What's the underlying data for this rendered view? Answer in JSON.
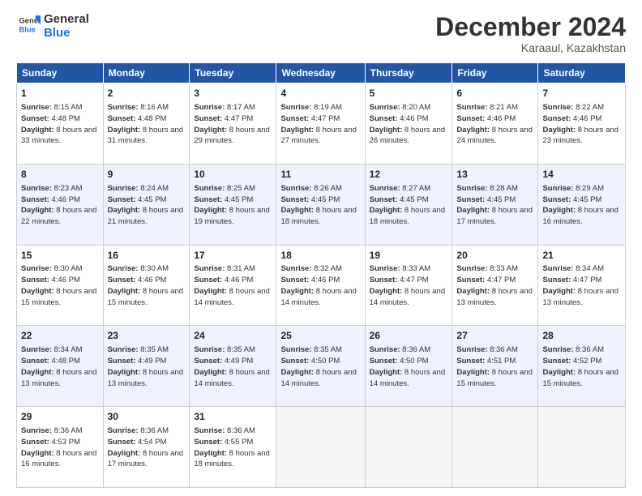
{
  "header": {
    "logo_line1": "General",
    "logo_line2": "Blue",
    "month": "December 2024",
    "location": "Karaaul, Kazakhstan"
  },
  "days_of_week": [
    "Sunday",
    "Monday",
    "Tuesday",
    "Wednesday",
    "Thursday",
    "Friday",
    "Saturday"
  ],
  "weeks": [
    [
      {
        "day": 1,
        "sunrise": "8:15 AM",
        "sunset": "4:48 PM",
        "daylight": "8 hours and 33 minutes."
      },
      {
        "day": 2,
        "sunrise": "8:16 AM",
        "sunset": "4:48 PM",
        "daylight": "8 hours and 31 minutes."
      },
      {
        "day": 3,
        "sunrise": "8:17 AM",
        "sunset": "4:47 PM",
        "daylight": "8 hours and 29 minutes."
      },
      {
        "day": 4,
        "sunrise": "8:19 AM",
        "sunset": "4:47 PM",
        "daylight": "8 hours and 27 minutes."
      },
      {
        "day": 5,
        "sunrise": "8:20 AM",
        "sunset": "4:46 PM",
        "daylight": "8 hours and 26 minutes."
      },
      {
        "day": 6,
        "sunrise": "8:21 AM",
        "sunset": "4:46 PM",
        "daylight": "8 hours and 24 minutes."
      },
      {
        "day": 7,
        "sunrise": "8:22 AM",
        "sunset": "4:46 PM",
        "daylight": "8 hours and 23 minutes."
      }
    ],
    [
      {
        "day": 8,
        "sunrise": "8:23 AM",
        "sunset": "4:46 PM",
        "daylight": "8 hours and 22 minutes."
      },
      {
        "day": 9,
        "sunrise": "8:24 AM",
        "sunset": "4:45 PM",
        "daylight": "8 hours and 21 minutes."
      },
      {
        "day": 10,
        "sunrise": "8:25 AM",
        "sunset": "4:45 PM",
        "daylight": "8 hours and 19 minutes."
      },
      {
        "day": 11,
        "sunrise": "8:26 AM",
        "sunset": "4:45 PM",
        "daylight": "8 hours and 18 minutes."
      },
      {
        "day": 12,
        "sunrise": "8:27 AM",
        "sunset": "4:45 PM",
        "daylight": "8 hours and 18 minutes."
      },
      {
        "day": 13,
        "sunrise": "8:28 AM",
        "sunset": "4:45 PM",
        "daylight": "8 hours and 17 minutes."
      },
      {
        "day": 14,
        "sunrise": "8:29 AM",
        "sunset": "4:45 PM",
        "daylight": "8 hours and 16 minutes."
      }
    ],
    [
      {
        "day": 15,
        "sunrise": "8:30 AM",
        "sunset": "4:46 PM",
        "daylight": "8 hours and 15 minutes."
      },
      {
        "day": 16,
        "sunrise": "8:30 AM",
        "sunset": "4:46 PM",
        "daylight": "8 hours and 15 minutes."
      },
      {
        "day": 17,
        "sunrise": "8:31 AM",
        "sunset": "4:46 PM",
        "daylight": "8 hours and 14 minutes."
      },
      {
        "day": 18,
        "sunrise": "8:32 AM",
        "sunset": "4:46 PM",
        "daylight": "8 hours and 14 minutes."
      },
      {
        "day": 19,
        "sunrise": "8:33 AM",
        "sunset": "4:47 PM",
        "daylight": "8 hours and 14 minutes."
      },
      {
        "day": 20,
        "sunrise": "8:33 AM",
        "sunset": "4:47 PM",
        "daylight": "8 hours and 13 minutes."
      },
      {
        "day": 21,
        "sunrise": "8:34 AM",
        "sunset": "4:47 PM",
        "daylight": "8 hours and 13 minutes."
      }
    ],
    [
      {
        "day": 22,
        "sunrise": "8:34 AM",
        "sunset": "4:48 PM",
        "daylight": "8 hours and 13 minutes."
      },
      {
        "day": 23,
        "sunrise": "8:35 AM",
        "sunset": "4:49 PM",
        "daylight": "8 hours and 13 minutes."
      },
      {
        "day": 24,
        "sunrise": "8:35 AM",
        "sunset": "4:49 PM",
        "daylight": "8 hours and 14 minutes."
      },
      {
        "day": 25,
        "sunrise": "8:35 AM",
        "sunset": "4:50 PM",
        "daylight": "8 hours and 14 minutes."
      },
      {
        "day": 26,
        "sunrise": "8:36 AM",
        "sunset": "4:50 PM",
        "daylight": "8 hours and 14 minutes."
      },
      {
        "day": 27,
        "sunrise": "8:36 AM",
        "sunset": "4:51 PM",
        "daylight": "8 hours and 15 minutes."
      },
      {
        "day": 28,
        "sunrise": "8:36 AM",
        "sunset": "4:52 PM",
        "daylight": "8 hours and 15 minutes."
      }
    ],
    [
      {
        "day": 29,
        "sunrise": "8:36 AM",
        "sunset": "4:53 PM",
        "daylight": "8 hours and 16 minutes."
      },
      {
        "day": 30,
        "sunrise": "8:36 AM",
        "sunset": "4:54 PM",
        "daylight": "8 hours and 17 minutes."
      },
      {
        "day": 31,
        "sunrise": "8:36 AM",
        "sunset": "4:55 PM",
        "daylight": "8 hours and 18 minutes."
      },
      null,
      null,
      null,
      null
    ]
  ],
  "labels": {
    "sunrise": "Sunrise:",
    "sunset": "Sunset:",
    "daylight": "Daylight:"
  }
}
